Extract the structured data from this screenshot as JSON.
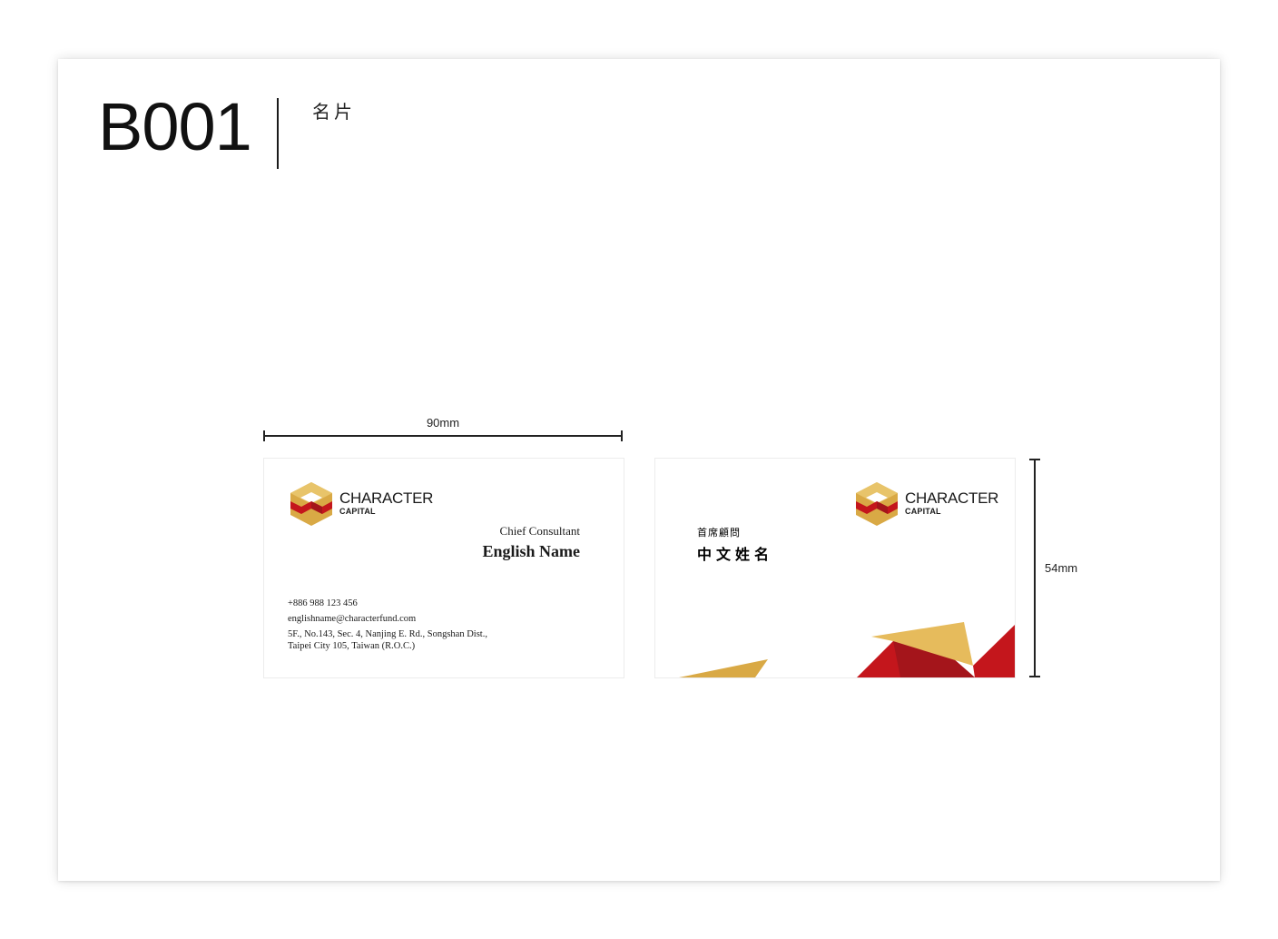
{
  "header": {
    "code": "B001",
    "subtitle": "名片"
  },
  "dimensions": {
    "width_label": "90mm",
    "height_label": "54mm"
  },
  "front": {
    "logo": {
      "brand": "CHARACTER",
      "sub": "CAPITAL"
    },
    "title": "Chief Consultant",
    "name": "English Name",
    "phone": "+886 988 123 456",
    "email": "englishname@characterfund.com",
    "address_line1": "5F., No.143, Sec. 4, Nanjing E. Rd., Songshan Dist.,",
    "address_line2": "Taipei City 105, Taiwan (R.O.C.)"
  },
  "back": {
    "logo": {
      "brand": "CHARACTER",
      "sub": "CAPITAL"
    },
    "title": "首席顧問",
    "name": "中文姓名"
  },
  "colors": {
    "gold": "#d9a945",
    "gold_light": "#e6bb5c",
    "red": "#c4161c",
    "red_dark": "#a4151b"
  }
}
